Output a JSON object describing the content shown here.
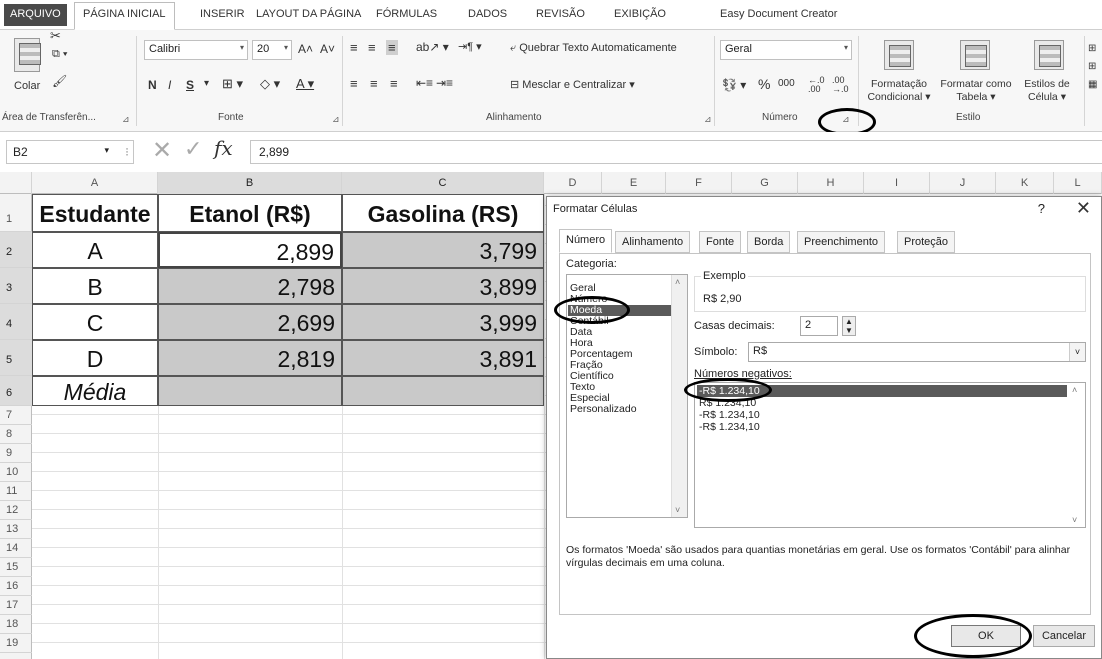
{
  "tabs": [
    "ARQUIVO",
    "PÁGINA INICIAL",
    "INSERIR",
    "LAYOUT DA PÁGINA",
    "FÓRMULAS",
    "DADOS",
    "REVISÃO",
    "EXIBIÇÃO",
    "Easy Document Creator"
  ],
  "ribbon": {
    "colar": "Colar",
    "font_name": "Calibri",
    "font_size": "20",
    "bold": "N",
    "italic": "I",
    "underline": "S",
    "quebrar": "Quebrar Texto Automaticamente",
    "mesclar": "Mesclar e Centralizar",
    "number_format": "Geral",
    "percent": "%",
    "thousands": "000",
    "formatacao_cond": "Formatação Condicional",
    "formatar_tabela": "Formatar como Tabela",
    "estilos_celula": "Estilos de Célula",
    "groups": {
      "clipboard": "Área de Transferên...",
      "font": "Fonte",
      "alignment": "Alinhamento",
      "number": "Número",
      "style": "Estilo"
    }
  },
  "formula_bar": {
    "cell_ref": "B2",
    "fx": "fx",
    "value": "2,899"
  },
  "columns": [
    "A",
    "B",
    "C",
    "D",
    "E",
    "F",
    "G",
    "H",
    "I",
    "J",
    "K",
    "L"
  ],
  "rows": [
    "1",
    "2",
    "3",
    "4",
    "5",
    "6",
    "7",
    "8",
    "9",
    "10",
    "11",
    "12",
    "13",
    "14",
    "15",
    "16",
    "17",
    "18",
    "19"
  ],
  "sheet": {
    "headers": [
      "Estudante",
      "Etanol (R$)",
      "Gasolina (RS)"
    ],
    "data": [
      [
        "A",
        "2,899",
        "3,799"
      ],
      [
        "B",
        "2,798",
        "3,899"
      ],
      [
        "C",
        "2,699",
        "3,999"
      ],
      [
        "D",
        "2,819",
        "3,891"
      ]
    ],
    "media_label": "Média"
  },
  "dialog": {
    "title": "Formatar Células",
    "help": "?",
    "close": "✕",
    "tabs": [
      "Número",
      "Alinhamento",
      "Fonte",
      "Borda",
      "Preenchimento",
      "Proteção"
    ],
    "categoria_label": "Categoria:",
    "categories": [
      "Geral",
      "Número",
      "Moeda",
      "Contábil",
      "Data",
      "Hora",
      "Porcentagem",
      "Fração",
      "Científico",
      "Texto",
      "Especial",
      "Personalizado"
    ],
    "selected_category": "Moeda",
    "exemplo_label": "Exemplo",
    "exemplo_value": "R$ 2,90",
    "casas_label": "Casas decimais:",
    "casas_value": "2",
    "simbolo_label": "Símbolo:",
    "simbolo_value": "R$",
    "negativos_label": "Números negativos:",
    "negatives": [
      "-R$ 1.234,10",
      "R$ 1.234,10",
      "-R$ 1.234,10",
      "-R$ 1.234,10"
    ],
    "description": "Os formatos 'Moeda' são usados para quantias monetárias em geral. Use os formatos 'Contábil' para alinhar vírgulas decimais em uma coluna.",
    "ok": "OK",
    "cancel": "Cancelar"
  }
}
